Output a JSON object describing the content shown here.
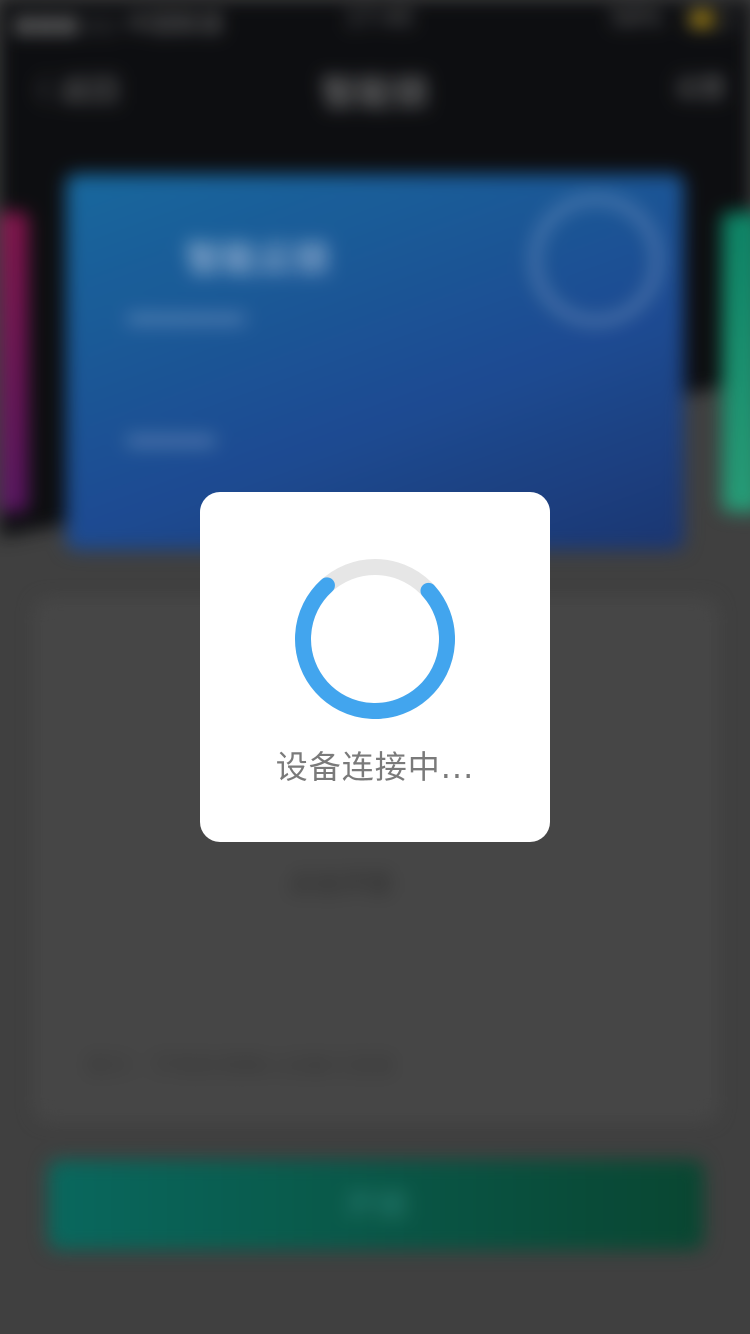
{
  "status_bar": {
    "carrier": "●●●○○ 中国联通",
    "time": "17:45",
    "battery": "58%"
  },
  "nav": {
    "back_label": "〈 返回",
    "title": "智能锁",
    "action_label": "设置"
  },
  "card": {
    "title": "智能云锁"
  },
  "panel": {
    "mid_text": "点击开锁",
    "bottom_text": "提示：开锁前请确认设备已连接"
  },
  "primary_button": {
    "label": "开锁"
  },
  "dialog": {
    "message": "设备连接中...",
    "progress": 0.75
  },
  "colors": {
    "spinner_accent": "#42a5ee",
    "spinner_track": "#e6e6e6",
    "dialog_bg": "#ffffff",
    "battery": "#d8a800"
  }
}
